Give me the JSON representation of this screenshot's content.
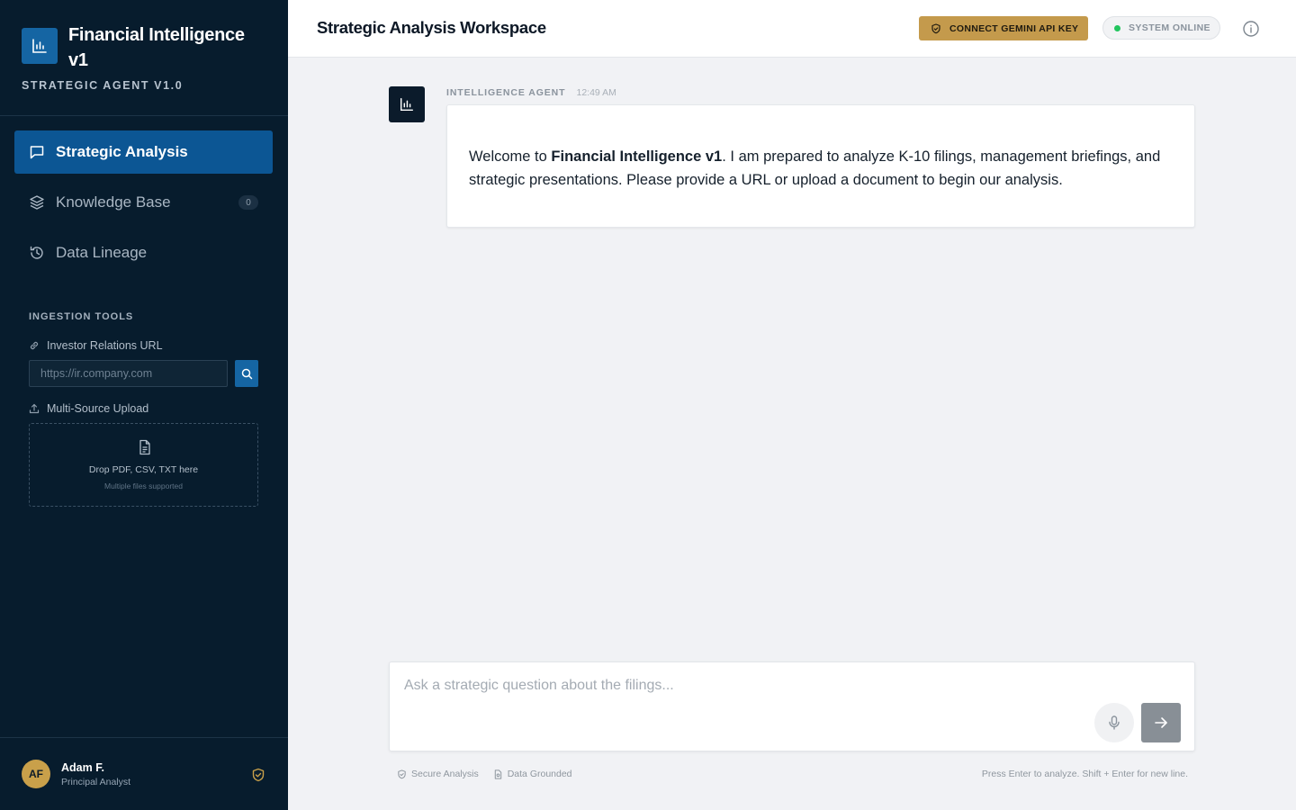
{
  "brand": {
    "title": "Financial Intelligence v1",
    "subtitle": "STRATEGIC AGENT V1.0",
    "logo_icon": "bar-chart-icon"
  },
  "nav": {
    "items": [
      {
        "label": "Strategic Analysis",
        "icon": "chat-bubble-icon",
        "active": true
      },
      {
        "label": "Knowledge Base",
        "icon": "layers-icon",
        "badge": "0"
      },
      {
        "label": "Data Lineage",
        "icon": "history-icon"
      }
    ]
  },
  "ingestion": {
    "title": "INGESTION TOOLS",
    "url_label": "Investor Relations URL",
    "url_placeholder": "https://ir.company.com",
    "upload_label": "Multi-Source Upload",
    "drop_main": "Drop PDF, CSV, TXT here",
    "drop_sub": "Multiple files supported"
  },
  "user": {
    "initials": "AF",
    "name": "Adam F.",
    "role": "Principal Analyst"
  },
  "header": {
    "title": "Strategic Analysis Workspace",
    "api_button": "CONNECT GEMINI API KEY",
    "status": "SYSTEM ONLINE",
    "colors": {
      "accent": "#c49a4c",
      "status_dot": "#22c55e"
    }
  },
  "chat": {
    "messages": [
      {
        "author": "INTELLIGENCE AGENT",
        "time": "12:49 AM",
        "text_prefix": "Welcome to ",
        "text_bold": "Financial Intelligence v1",
        "text_suffix": ". I am prepared to analyze K-10 filings, management briefings, and strategic presentations. Please provide a URL or upload a document to begin our analysis."
      }
    ]
  },
  "composer": {
    "placeholder": "Ask a strategic question about the filings...",
    "footer_secure": "Secure Analysis",
    "footer_grounded": "Data Grounded",
    "footer_hint": "Press Enter to analyze. Shift + Enter for new line."
  },
  "colors": {
    "sidebar_bg": "#071c2d",
    "nav_active": "#0c5694",
    "brand_blue": "#1565a3"
  }
}
